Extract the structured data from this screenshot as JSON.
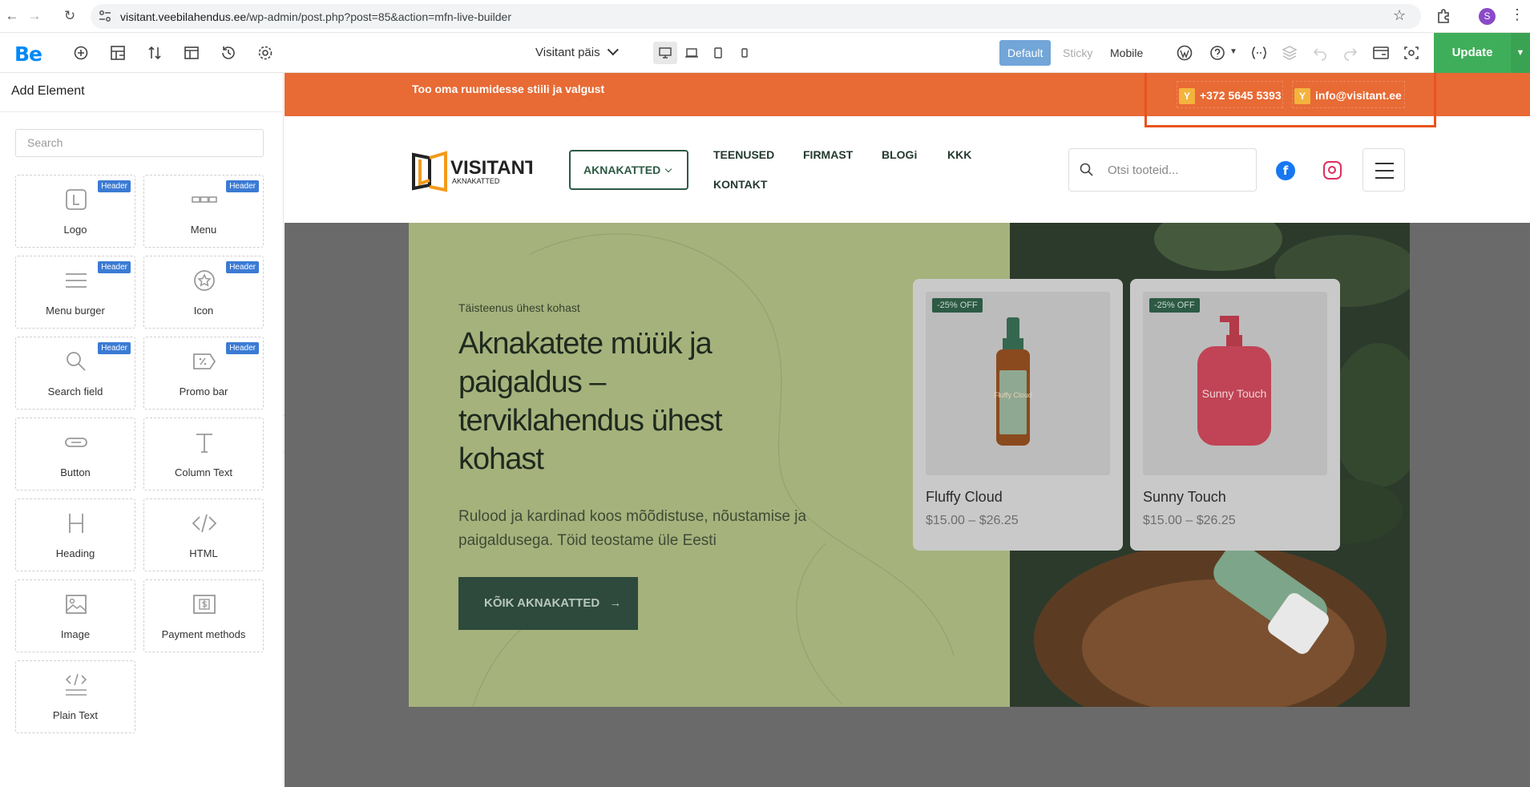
{
  "browser": {
    "url_host": "visitant.veebilahendus.ee",
    "url_path": "/wp-admin/post.php?post=85&action=mfn-live-builder",
    "avatar_letter": "S"
  },
  "toolbar": {
    "logo": "Be",
    "view_name": "Visitant päis",
    "modes": [
      "Default",
      "Sticky",
      "Mobile"
    ],
    "update_label": "Update"
  },
  "sidebar": {
    "title": "Add Element",
    "search_placeholder": "Search",
    "badge_label": "Header",
    "elements": [
      {
        "label": "Logo",
        "icon": "logo-icon",
        "badge": true
      },
      {
        "label": "Menu",
        "icon": "menu-icon",
        "badge": true
      },
      {
        "label": "Menu burger",
        "icon": "menu-burger-icon",
        "badge": true
      },
      {
        "label": "Icon",
        "icon": "star-icon",
        "badge": true
      },
      {
        "label": "Search field",
        "icon": "search-icon",
        "badge": true
      },
      {
        "label": "Promo bar",
        "icon": "tag-icon",
        "badge": true
      },
      {
        "label": "Button",
        "icon": "button-icon",
        "badge": false
      },
      {
        "label": "Column Text",
        "icon": "text-icon",
        "badge": false
      },
      {
        "label": "Heading",
        "icon": "heading-icon",
        "badge": false
      },
      {
        "label": "HTML",
        "icon": "code-icon",
        "badge": false
      },
      {
        "label": "Image",
        "icon": "image-icon",
        "badge": false
      },
      {
        "label": "Payment methods",
        "icon": "payment-icon",
        "badge": false
      },
      {
        "label": "Plain Text",
        "icon": "plain-text-icon",
        "badge": false
      }
    ]
  },
  "site": {
    "promo_text": "Too oma ruumidesse stiili ja valgust",
    "phone": "+372 5645 5393",
    "email": "info@visitant.ee",
    "logo_name": "VISITANT",
    "logo_sub": "AKNAKATTED",
    "dropdown_label": "AKNAKATTED",
    "nav": [
      "TEENUSED",
      "FIRMAST",
      "BLOGi",
      "KKK",
      "KONTAKT"
    ],
    "product_search_placeholder": "Otsi tooteid..."
  },
  "hero": {
    "eyebrow": "Täisteenus ühest kohast",
    "title": "Aknakatete müük ja paigaldus – terviklahendus ühest kohast",
    "subtitle": "Rulood ja kardinad koos mõõdistuse, nõustamise ja paigaldusega. Töid teostame üle Eesti",
    "cta": "KÕIK AKNAKATTED",
    "products": [
      {
        "badge": "-25% OFF",
        "name": "Fluffy Cloud",
        "price": "$15.00 – $26.25",
        "bottle_text": "Fluffy Cloud"
      },
      {
        "badge": "-25% OFF",
        "name": "Sunny Touch",
        "price": "$15.00 – $26.25",
        "bottle_text": "Sunny Touch"
      }
    ]
  },
  "colors": {
    "promo_bg": "#e86a34",
    "accent_green": "#2d5a44",
    "update_green": "#3fae5a",
    "be_blue": "#0089f7"
  }
}
